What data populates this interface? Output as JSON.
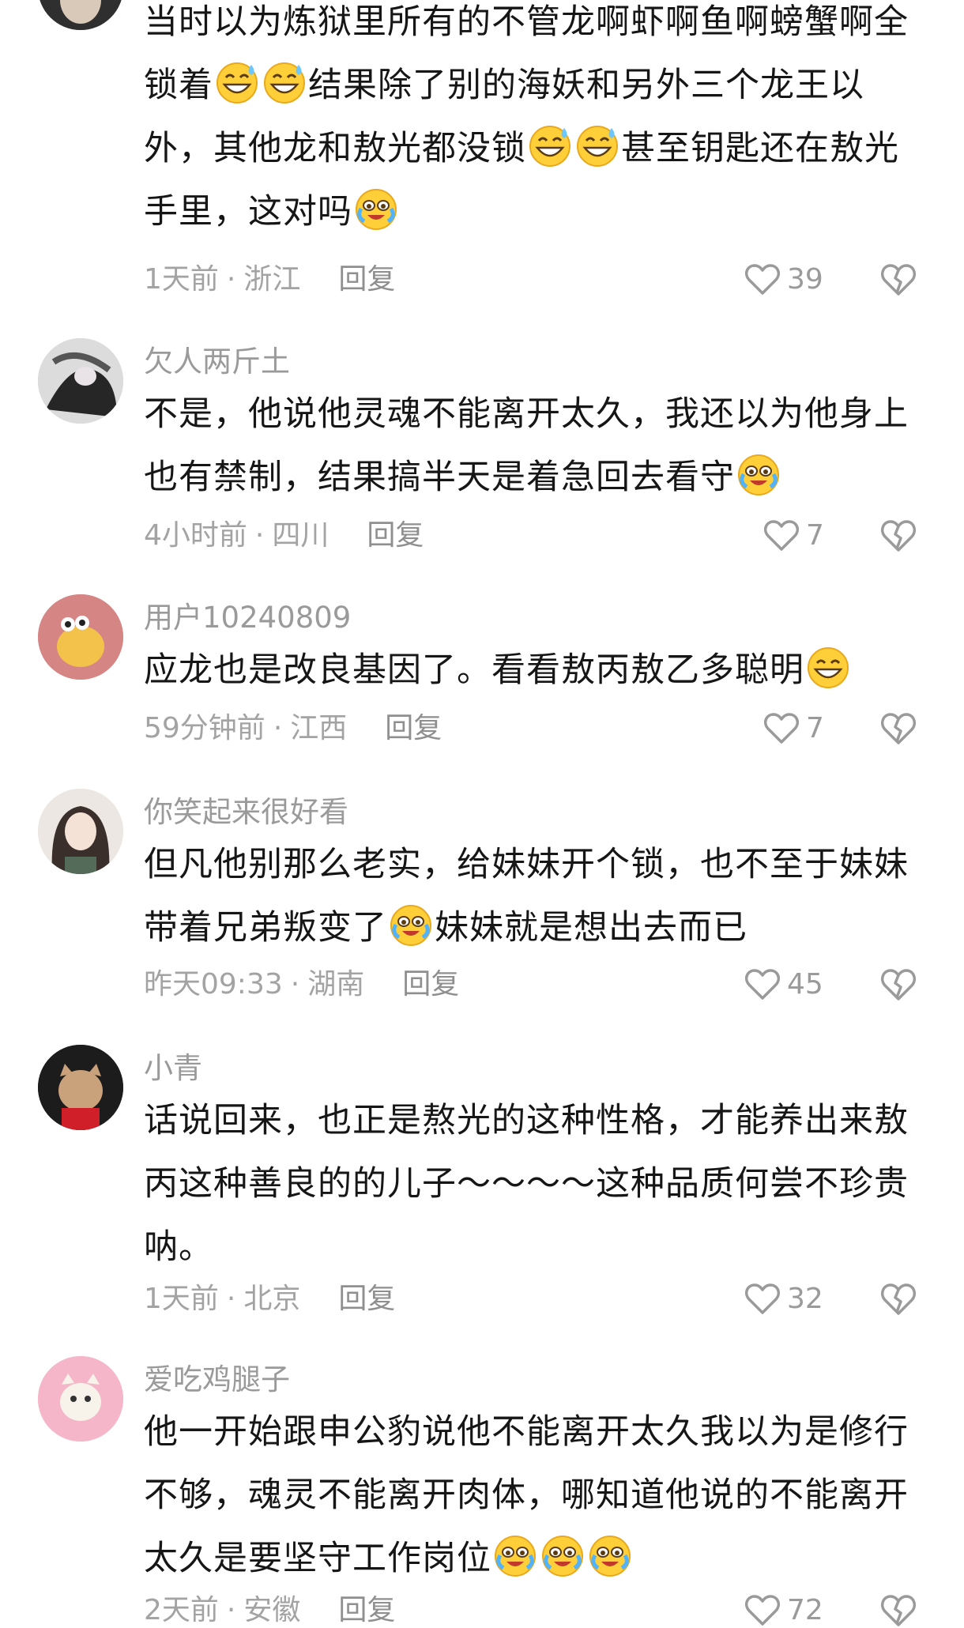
{
  "comments": [
    {
      "username": "",
      "lines": [
        "当时以为炼狱里所有的不管龙啊虾啊鱼啊螃蟹啊全",
        "锁着",
        "结果除了别的海妖和另外三个龙王以",
        "外，其他龙和敖光都没锁",
        "甚至钥匙还在敖光",
        "手里，这对吗"
      ],
      "time": "1天前",
      "location": "浙江",
      "reply_label": "回复",
      "likes": "39"
    },
    {
      "username": "欠人两斤土",
      "lines": [
        "不是，他说他灵魂不能离开太久，我还以为他身上",
        "也有禁制，结果搞半天是着急回去看守"
      ],
      "time": "4小时前",
      "location": "四川",
      "reply_label": "回复",
      "likes": "7"
    },
    {
      "username": "用户10240809",
      "lines": [
        "应龙也是改良基因了。看看敖丙敖乙多聪明"
      ],
      "time": "59分钟前",
      "location": "江西",
      "reply_label": "回复",
      "likes": "7"
    },
    {
      "username": "你笑起来很好看",
      "lines": [
        "但凡他别那么老实，给妹妹开个锁，也不至于妹妹",
        "带着兄弟叛变了",
        "妹妹就是想出去而已"
      ],
      "time": "昨天09:33",
      "location": "湖南",
      "reply_label": "回复",
      "likes": "45"
    },
    {
      "username": "小青",
      "lines": [
        "话说回来，也正是熬光的这种性格，才能养出来敖",
        "丙这种善良的的儿子～～～～这种品质何尝不珍贵",
        "呐。"
      ],
      "time": "1天前",
      "location": "北京",
      "reply_label": "回复",
      "likes": "32"
    },
    {
      "username": "爱吃鸡腿子",
      "lines": [
        "他一开始跟申公豹说他不能离开太久我以为是修行",
        "不够，魂灵不能离开肉体，哪知道他说的不能离开",
        "太久是要坚守工作岗位"
      ],
      "time": "2天前",
      "location": "安徽",
      "reply_label": "回复",
      "likes": "72"
    }
  ],
  "icons": {
    "like": "heart-outline-icon",
    "dislike": "broken-heart-icon",
    "emoji_sweat": "grinning-sweat-emoji",
    "emoji_cry": "crying-laughing-emoji",
    "emoji_grin": "grinning-emoji"
  },
  "colors": {
    "meta_gray": "#a3a3a3",
    "text": "#161616",
    "emoji_yellow": "#ffcf3a"
  }
}
